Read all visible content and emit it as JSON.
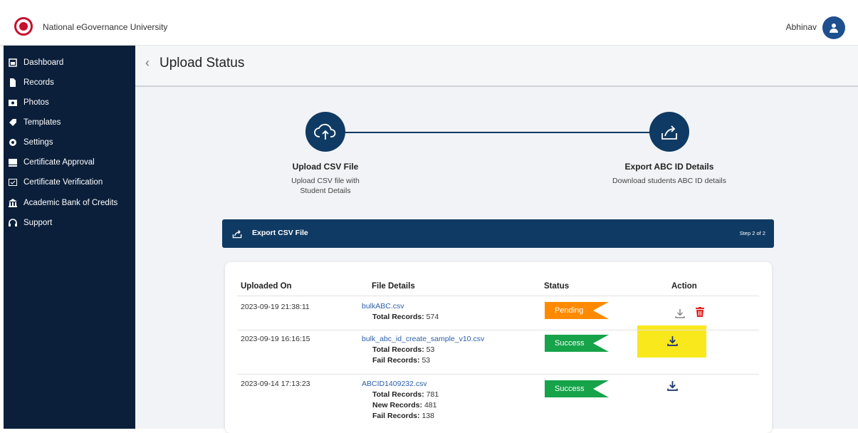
{
  "header": {
    "brand": "National eGovernance University",
    "user": "Abhinav"
  },
  "sidebar": {
    "items": [
      {
        "label": "Dashboard",
        "icon": "dashboard-icon"
      },
      {
        "label": "Records",
        "icon": "file-icon"
      },
      {
        "label": "Photos",
        "icon": "photos-icon"
      },
      {
        "label": "Templates",
        "icon": "tag-icon"
      },
      {
        "label": "Settings",
        "icon": "gear-icon"
      },
      {
        "label": "Certificate Approval",
        "icon": "approval-icon"
      },
      {
        "label": "Certificate Verification",
        "icon": "verification-icon"
      },
      {
        "label": "Academic Bank of Credits",
        "icon": "bank-icon"
      },
      {
        "label": "Support",
        "icon": "headset-icon"
      }
    ]
  },
  "page": {
    "back": "‹",
    "title": "Upload Status"
  },
  "steps": [
    {
      "title": "Upload CSV File",
      "desc_line1": "Upload CSV file with",
      "desc_line2": "Student Details",
      "icon": "cloud-upload-icon"
    },
    {
      "title": "Export ABC ID Details",
      "desc_line1": "Download students ABC ID details",
      "desc_line2": "",
      "icon": "export-share-icon"
    }
  ],
  "banner": {
    "title": "Export CSV File",
    "step": "Step 2 of 2",
    "icon": "export-share-icon"
  },
  "table": {
    "headers": [
      "Uploaded On",
      "File Details",
      "Status",
      "Action"
    ],
    "rows": [
      {
        "uploaded_on": "2023-09-19 21:38:11",
        "file": "bulkABC.csv",
        "l1_label": "Total Records:",
        "l1_value": " 574",
        "status": "Pending",
        "status_color": "#ff8a00"
      },
      {
        "uploaded_on": "2023-09-19 16:16:15",
        "file": "bulk_abc_id_create_sample_v10.csv",
        "l1_label": "Total Records:",
        "l1_value": " 53",
        "l2_label": "Fail Records:",
        "l2_value": " 53",
        "status": "Success",
        "status_color": "#16a34a"
      },
      {
        "uploaded_on": "2023-09-14 17:13:23",
        "file": "ABCID1409232.csv",
        "l1_label": "Total Records:",
        "l1_value": " 781",
        "l2_label": "New Records:",
        "l2_value": " 481",
        "l3_label": "Fail Records:",
        "l3_value": " 138",
        "status": "Success",
        "status_color": "#16a34a"
      }
    ]
  },
  "colors": {
    "sidebar": "#0b1f3a",
    "primary": "#0f3a63",
    "highlight": "#f8e81c",
    "delete": "#e02424"
  }
}
